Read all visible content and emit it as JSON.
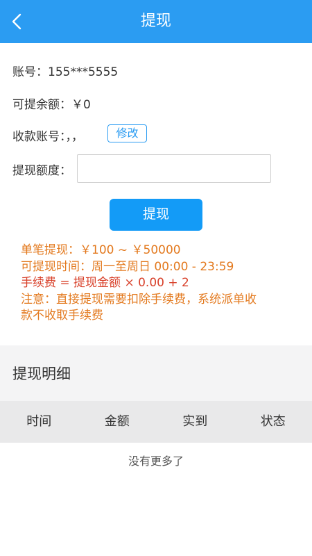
{
  "header": {
    "title": "提现",
    "back_icon": "chevron-left-icon"
  },
  "account": {
    "label": "账号：",
    "value": "155***5555"
  },
  "balance": {
    "label": "可提余额：",
    "value": "￥0"
  },
  "receive_account": {
    "label": "收款账号：",
    "value": "，，",
    "edit_label": "修改"
  },
  "amount": {
    "label": "提现额度：",
    "value": "",
    "placeholder": ""
  },
  "submit_label": "提现",
  "notes": [
    {
      "text": "单笔提现：￥100 ~ ￥50000",
      "color": "#e3791e"
    },
    {
      "text": "可提现时间：周一至周日 00:00 - 23:59",
      "color": "#e3791e"
    },
    {
      "text": "手续费 = 提现金额 × 0.00 + 2",
      "color": "#d8402a"
    },
    {
      "text": "注意：直接提现需要扣除手续费，系统派单收\n款不收取手续费",
      "color": "#e3791e"
    }
  ],
  "details": {
    "title": "提现明细",
    "columns": [
      "时间",
      "金额",
      "实到",
      "状态"
    ],
    "empty_text": "没有更多了"
  },
  "colors": {
    "primary": "#2b9cf2",
    "button": "#139bf7"
  }
}
